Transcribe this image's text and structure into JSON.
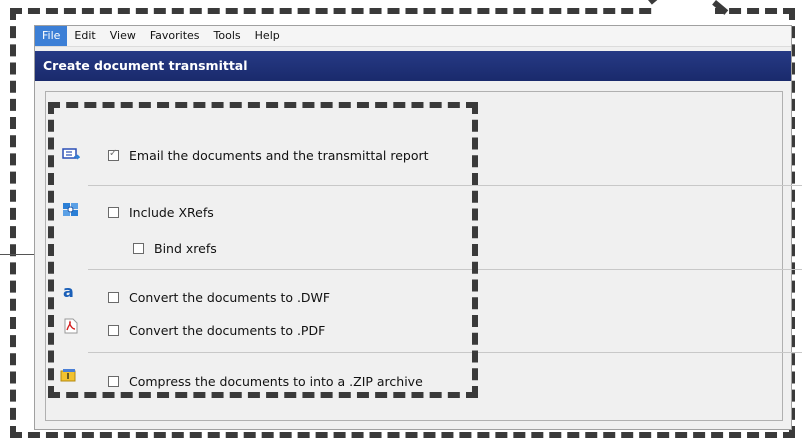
{
  "menu": {
    "items": [
      "File",
      "Edit",
      "View",
      "Favorites",
      "Tools",
      "Help"
    ],
    "active": "File"
  },
  "dialog": {
    "title": "Create document transmittal"
  },
  "options": {
    "email": {
      "label": "Email the documents and the transmittal report",
      "checked": true
    },
    "include_xrefs": {
      "label": "Include XRefs",
      "checked": false
    },
    "bind_xrefs": {
      "label": "Bind xrefs",
      "checked": false
    },
    "convert_dwf": {
      "label": "Convert the documents to .DWF",
      "checked": false
    },
    "convert_pdf": {
      "label": "Convert the documents to .PDF",
      "checked": false
    },
    "compress_zip": {
      "label": "Compress the documents to into a .ZIP archive",
      "checked": false
    }
  },
  "icons": {
    "email": "email-send-icon",
    "xrefs": "xref-icon",
    "dwf": "autodesk-a-icon",
    "pdf": "pdf-icon",
    "zip": "zip-archive-icon"
  },
  "colors": {
    "title_bar": "#1f3078",
    "menu_active": "#3c7fd6"
  }
}
